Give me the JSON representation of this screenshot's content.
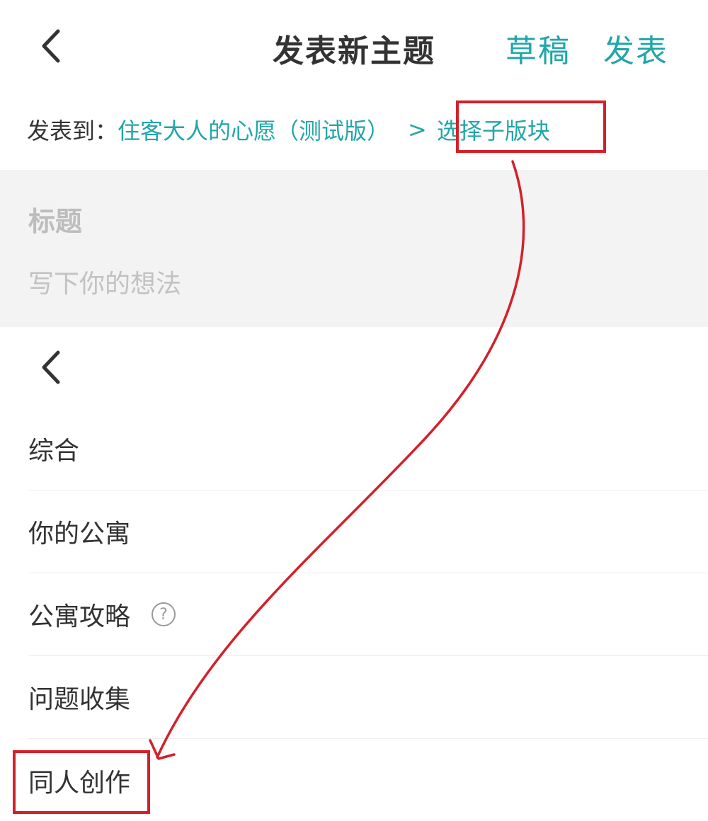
{
  "header": {
    "title": "发表新主题",
    "draft_label": "草稿",
    "publish_label": "发表"
  },
  "post_to": {
    "label": "发表到：",
    "forum": "住客大人的心愿（测试版）",
    "chevron": ">",
    "select_subforum": "选择子版块"
  },
  "editor": {
    "title_placeholder": "标题",
    "content_placeholder": "写下你的想法"
  },
  "subforums": {
    "items": [
      {
        "label": "综合"
      },
      {
        "label": "你的公寓"
      },
      {
        "label": "公寓攻略",
        "help_icon": "?"
      },
      {
        "label": "问题收集"
      },
      {
        "label": "同人创作"
      }
    ]
  },
  "colors": {
    "accent": "#21a6a9",
    "annotation": "#d4202a"
  }
}
